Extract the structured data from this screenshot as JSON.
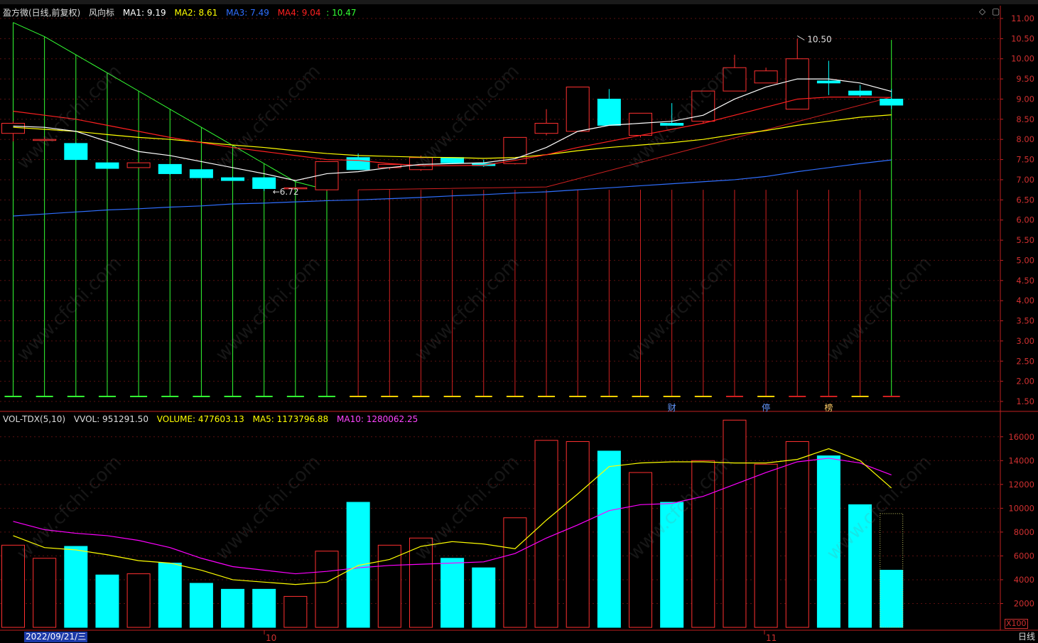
{
  "main_legend": {
    "title": "盈方微(日线,前复权)",
    "indicator": "风向标",
    "ma1": "MA1: 9.19",
    "ma2": "MA2: 8.61",
    "ma3": "MA3: 7.49",
    "ma4": "MA4: 9.04",
    "extra": ": 10.47"
  },
  "vol_legend": {
    "title": "VOL-TDX(5,10)",
    "vvol": "VVOL: 951291.50",
    "volume": "VOLUME: 477603.13",
    "ma5": "MA5: 1173796.88",
    "ma10": "MA10: 1280062.25"
  },
  "colors": {
    "up": "#ff3030",
    "down": "#00ffff",
    "ma1": "#ffffff",
    "ma2": "#ffff00",
    "ma3": "#2f6fff",
    "ma4": "#ff2020",
    "vol_ma5": "#ffff00",
    "vol_ma10": "#ff00ff",
    "wind_green": "#33ff33",
    "wind_red": "#d02020"
  },
  "price_axis": {
    "ticks": [
      "11.00",
      "10.50",
      "10.00",
      "9.50",
      "9.00",
      "8.50",
      "8.00",
      "7.50",
      "7.00",
      "6.50",
      "6.00",
      "5.50",
      "5.00",
      "4.50",
      "4.00",
      "3.50",
      "3.00",
      "2.50",
      "2.00",
      "1.50"
    ],
    "ylim": [
      1.5,
      11.0
    ]
  },
  "volume_axis": {
    "ticks": [
      "16000",
      "14000",
      "12000",
      "10000",
      "8000",
      "6000",
      "4000",
      "2000"
    ],
    "unit": "X100",
    "ylim": [
      0,
      17000
    ]
  },
  "annotations": {
    "high": "10.50",
    "low": "6.72",
    "markers": [
      "财",
      "停",
      "榜"
    ]
  },
  "x_labels": {
    "date_box": "2022/09/21/三",
    "oct": "10",
    "nov": "11",
    "period": "日线"
  },
  "icons": {
    "diamond": "diamond-icon",
    "window": "window-icon"
  },
  "watermark": "www.cfchi.com",
  "chart_data": {
    "type": "candlestick",
    "candles": [
      {
        "o": 8.15,
        "h": 8.45,
        "l": 7.95,
        "c": 8.4,
        "v": 6900
      },
      {
        "o": 8.0,
        "h": 8.05,
        "l": 7.95,
        "c": 8.0,
        "v": 5800
      },
      {
        "o": 7.9,
        "h": 7.92,
        "l": 7.5,
        "c": 7.5,
        "v": 6800
      },
      {
        "o": 7.42,
        "h": 7.42,
        "l": 7.28,
        "c": 7.28,
        "v": 4400
      },
      {
        "o": 7.3,
        "h": 7.42,
        "l": 7.3,
        "c": 7.42,
        "v": 4500
      },
      {
        "o": 7.38,
        "h": 7.38,
        "l": 7.12,
        "c": 7.15,
        "v": 5400
      },
      {
        "o": 7.25,
        "h": 7.25,
        "l": 7.05,
        "c": 7.05,
        "v": 3700
      },
      {
        "o": 7.05,
        "h": 7.08,
        "l": 6.98,
        "c": 6.98,
        "v": 3200
      },
      {
        "o": 7.05,
        "h": 7.05,
        "l": 6.72,
        "c": 6.78,
        "v": 3200
      },
      {
        "o": 6.8,
        "h": 6.82,
        "l": 6.78,
        "c": 6.8,
        "v": 2600
      },
      {
        "o": 6.75,
        "h": 7.45,
        "l": 6.72,
        "c": 7.45,
        "v": 6400
      },
      {
        "o": 7.55,
        "h": 7.65,
        "l": 7.25,
        "c": 7.25,
        "v": 10500
      },
      {
        "o": 7.3,
        "h": 7.4,
        "l": 7.25,
        "c": 7.38,
        "v": 6900
      },
      {
        "o": 7.25,
        "h": 7.6,
        "l": 7.22,
        "c": 7.55,
        "v": 7500
      },
      {
        "o": 7.55,
        "h": 7.55,
        "l": 7.4,
        "c": 7.42,
        "v": 5800
      },
      {
        "o": 7.4,
        "h": 7.5,
        "l": 7.32,
        "c": 7.35,
        "v": 5000
      },
      {
        "o": 7.4,
        "h": 8.05,
        "l": 7.38,
        "c": 8.05,
        "v": 9200
      },
      {
        "o": 8.15,
        "h": 8.75,
        "l": 8.1,
        "c": 8.4,
        "v": 15700
      },
      {
        "o": 8.2,
        "h": 9.3,
        "l": 8.2,
        "c": 9.3,
        "v": 15600
      },
      {
        "o": 9.0,
        "h": 9.25,
        "l": 8.35,
        "c": 8.35,
        "v": 14800
      },
      {
        "o": 8.1,
        "h": 8.65,
        "l": 8.05,
        "c": 8.65,
        "v": 13000
      },
      {
        "o": 8.4,
        "h": 8.9,
        "l": 8.35,
        "c": 8.35,
        "v": 10500
      },
      {
        "o": 8.45,
        "h": 9.2,
        "l": 8.4,
        "c": 9.2,
        "v": 14000
      },
      {
        "o": 9.2,
        "h": 10.1,
        "l": 9.2,
        "c": 9.78,
        "v": 17400
      },
      {
        "o": 9.4,
        "h": 9.78,
        "l": 9.4,
        "c": 9.7,
        "v": 13700
      },
      {
        "o": 8.75,
        "h": 10.5,
        "l": 8.75,
        "c": 10.0,
        "v": 15600
      },
      {
        "o": 9.45,
        "h": 9.95,
        "l": 9.1,
        "c": 9.4,
        "v": 14400
      },
      {
        "o": 9.2,
        "h": 9.35,
        "l": 9.05,
        "c": 9.1,
        "v": 10300
      },
      {
        "o": 9.0,
        "h": 9.25,
        "l": 8.75,
        "c": 8.85,
        "v": 4800
      }
    ],
    "vol_outline_last": 9550,
    "ma1": [
      8.33,
      8.3,
      8.2,
      7.95,
      7.7,
      7.6,
      7.45,
      7.3,
      7.15,
      6.98,
      7.15,
      7.2,
      7.3,
      7.38,
      7.4,
      7.42,
      7.52,
      7.8,
      8.2,
      8.35,
      8.4,
      8.45,
      8.6,
      9.0,
      9.3,
      9.5,
      9.5,
      9.4,
      9.19
    ],
    "ma2": [
      8.3,
      8.25,
      8.2,
      8.12,
      8.05,
      8.0,
      7.93,
      7.86,
      7.8,
      7.72,
      7.65,
      7.6,
      7.58,
      7.56,
      7.55,
      7.53,
      7.55,
      7.62,
      7.72,
      7.8,
      7.86,
      7.92,
      8.0,
      8.12,
      8.22,
      8.35,
      8.45,
      8.55,
      8.61
    ],
    "ma3": [
      6.1,
      6.15,
      6.2,
      6.25,
      6.28,
      6.32,
      6.35,
      6.4,
      6.42,
      6.45,
      6.48,
      6.5,
      6.53,
      6.56,
      6.6,
      6.63,
      6.67,
      6.7,
      6.75,
      6.8,
      6.85,
      6.9,
      6.95,
      7.0,
      7.08,
      7.2,
      7.3,
      7.4,
      7.49
    ],
    "ma4": [
      8.7,
      8.6,
      8.5,
      8.35,
      8.2,
      8.05,
      7.92,
      7.8,
      7.7,
      7.6,
      7.5,
      7.48,
      7.4,
      7.35,
      7.35,
      7.36,
      7.48,
      7.62,
      7.8,
      7.95,
      8.1,
      8.25,
      8.4,
      8.6,
      8.8,
      9.0,
      9.05,
      9.05,
      9.04
    ],
    "vol_ma5": [
      7700,
      6700,
      6500,
      6100,
      5600,
      5400,
      4800,
      4000,
      3800,
      3600,
      3800,
      5200,
      5700,
      6800,
      7200,
      7000,
      6600,
      9000,
      11200,
      13500,
      13800,
      13900,
      13900,
      13800,
      13800,
      14100,
      15000,
      14000,
      11700
    ],
    "vol_ma10": [
      8900,
      8200,
      7900,
      7700,
      7300,
      6700,
      5800,
      5100,
      4800,
      4500,
      4700,
      5000,
      5200,
      5300,
      5400,
      5500,
      6200,
      7500,
      8600,
      9800,
      10300,
      10400,
      11000,
      12000,
      13000,
      13900,
      14200,
      13800,
      12800
    ],
    "wind_tops": [
      10.9,
      10.55,
      10.1,
      9.65,
      9.2,
      8.75,
      8.3,
      7.85,
      7.4,
      6.95,
      6.75
    ]
  }
}
